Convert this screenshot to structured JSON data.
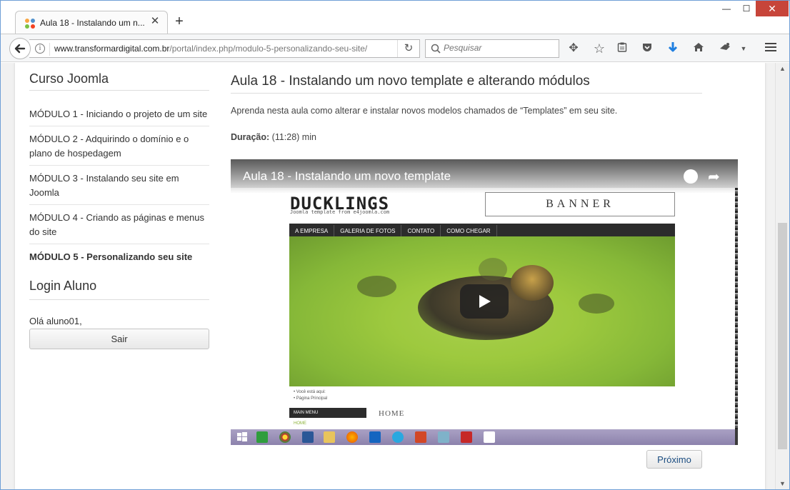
{
  "browser": {
    "tab_title": "Aula 18 - Instalando um n...",
    "url_domain": "www.transformardigital.com.br",
    "url_path": "/portal/index.php/modulo-5-personalizando-seu-site/",
    "search_placeholder": "Pesquisar",
    "window_controls": {
      "minimize": "—",
      "maximize": "☐",
      "close": "✕"
    },
    "close_tab": "✕",
    "new_tab": "+"
  },
  "sidebar": {
    "heading": "Curso Joomla",
    "items": [
      {
        "label": "MÓDULO 1 - Iniciando o projeto de um site"
      },
      {
        "label": "MÓDULO 2 - Adquirindo o domínio e o plano de hospedagem"
      },
      {
        "label": "MÓDULO 3 - Instalando seu site em Joomla"
      },
      {
        "label": "MÓDULO 4 - Criando as páginas e menus do site"
      },
      {
        "label": "MÓDULO 5 - Personalizando seu site",
        "active": true
      }
    ],
    "login_heading": "Login Aluno",
    "greeting": "Olá aluno01,",
    "logout_label": "Sair"
  },
  "main": {
    "title": "Aula 18 - Instalando um novo template e alterando módulos",
    "description": "Aprenda nesta aula como alterar e instalar novos modelos chamados de “Templates” em seu site.",
    "duration_label": "Duração:",
    "duration_value": " (11:28) min",
    "next_label": "Próximo"
  },
  "video": {
    "title": "Aula 18 - Instalando um novo template",
    "site_logo": "DUCKLINGS",
    "site_logo_sub": "Joomla template from e4joomla.com",
    "banner": "BANNER",
    "menu": [
      "A EMPRESA",
      "GALERIA DE FOTOS",
      "CONTATO",
      "COMO CHEGAR"
    ],
    "crumbs": [
      "• Você está aqui:",
      "• Página Principal"
    ],
    "main_menu": "MAIN MENU",
    "home_heading": "HOME",
    "home_link": "HOME"
  },
  "colors": {
    "accent_close": "#c7453a",
    "link_blue": "#1a4c80",
    "download_blue": "#1f7fe0"
  }
}
